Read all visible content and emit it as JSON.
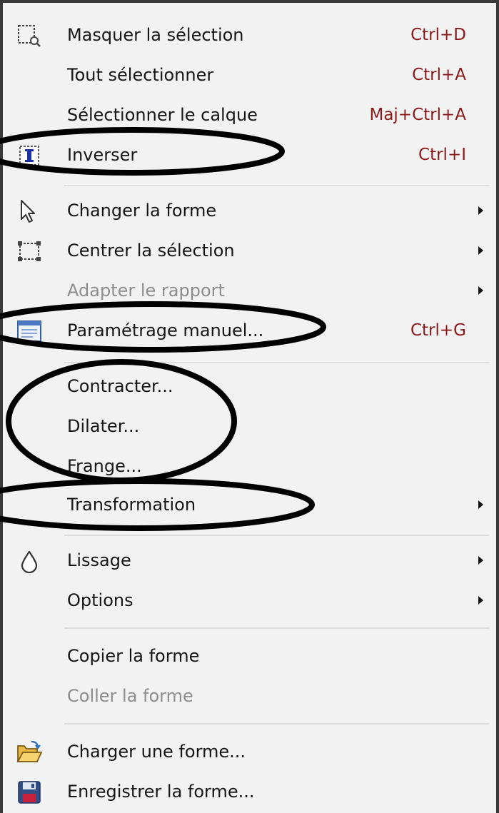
{
  "menu": {
    "items": [
      {
        "label": "Masquer la sélection",
        "shortcut": "Ctrl+D",
        "icon": "selection-hide-icon",
        "disabled": false,
        "submenu": false
      },
      {
        "label": "Tout sélectionner",
        "shortcut": "Ctrl+A",
        "icon": null,
        "disabled": false,
        "submenu": false
      },
      {
        "label": "Sélectionner le calque",
        "shortcut": "Maj+Ctrl+A",
        "icon": null,
        "disabled": false,
        "submenu": false
      },
      {
        "label": "Inverser",
        "shortcut": "Ctrl+I",
        "icon": "invert-icon",
        "disabled": false,
        "submenu": false
      },
      {
        "label": "Changer la forme",
        "shortcut": "",
        "icon": "cursor-arrow-icon",
        "disabled": false,
        "submenu": true
      },
      {
        "label": "Centrer la sélection",
        "shortcut": "",
        "icon": "center-selection-icon",
        "disabled": false,
        "submenu": true
      },
      {
        "label": "Adapter le rapport",
        "shortcut": "",
        "icon": null,
        "disabled": true,
        "submenu": true
      },
      {
        "label": "Paramétrage manuel...",
        "shortcut": "Ctrl+G",
        "icon": "manual-settings-icon",
        "disabled": false,
        "submenu": false
      },
      {
        "label": "Contracter...",
        "shortcut": "",
        "icon": null,
        "disabled": false,
        "submenu": false
      },
      {
        "label": "Dilater...",
        "shortcut": "",
        "icon": null,
        "disabled": false,
        "submenu": false
      },
      {
        "label": "Frange...",
        "shortcut": "",
        "icon": null,
        "disabled": false,
        "submenu": false
      },
      {
        "label": "Transformation",
        "shortcut": "",
        "icon": null,
        "disabled": false,
        "submenu": true
      },
      {
        "label": "Lissage",
        "shortcut": "",
        "icon": "drop-icon",
        "disabled": false,
        "submenu": true
      },
      {
        "label": "Options",
        "shortcut": "",
        "icon": null,
        "disabled": false,
        "submenu": true
      },
      {
        "label": "Copier la forme",
        "shortcut": "",
        "icon": null,
        "disabled": false,
        "submenu": false
      },
      {
        "label": "Coller la forme",
        "shortcut": "",
        "icon": null,
        "disabled": true,
        "submenu": false
      },
      {
        "label": "Charger une forme...",
        "shortcut": "",
        "icon": "open-folder-icon",
        "disabled": false,
        "submenu": false
      },
      {
        "label": "Enregistrer la forme...",
        "shortcut": "",
        "icon": "save-disk-icon",
        "disabled": false,
        "submenu": false
      }
    ]
  },
  "colors": {
    "menu_background": "#f2f2f2",
    "shortcut_text": "#8b1a1a",
    "disabled_text": "#8d8d8d",
    "annotation_stroke": "#000000"
  }
}
